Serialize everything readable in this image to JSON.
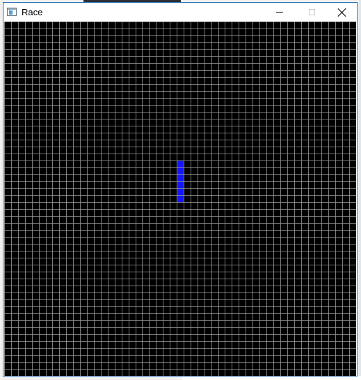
{
  "window": {
    "title": "Race",
    "icon": "app-window-icon",
    "controls": [
      "minimize-icon",
      "maximize-icon",
      "close-icon"
    ]
  },
  "game": {
    "grid": {
      "columns": 51,
      "rows": 51
    },
    "colors": {
      "background": "#000000",
      "grid_lines": "#9a9a9a",
      "car": "#1414ff"
    },
    "car": {
      "column": 25,
      "row": 20,
      "length": 6,
      "orientation": "vertical"
    }
  }
}
